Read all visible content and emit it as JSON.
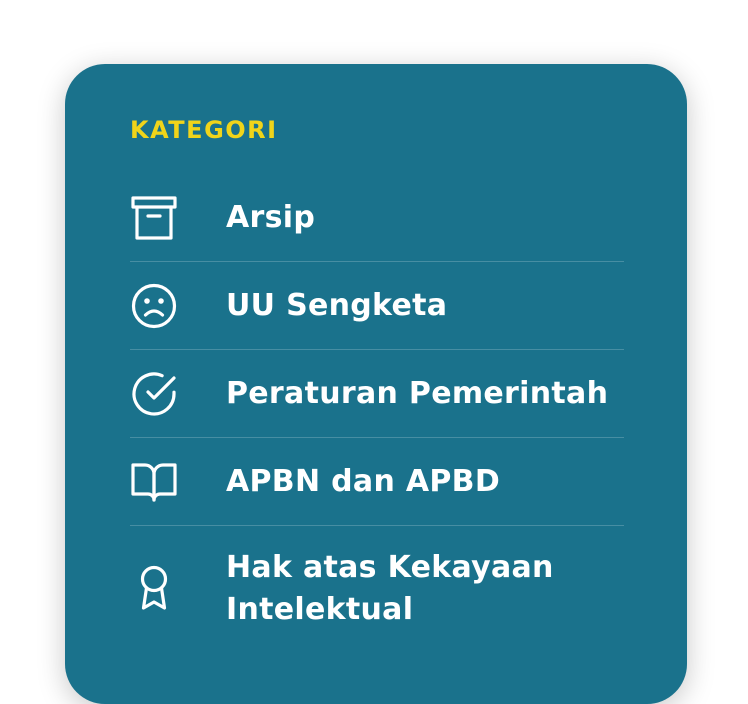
{
  "category_card": {
    "heading": "KATEGORI",
    "items": [
      {
        "label": "Arsip",
        "icon": "archive-box-icon"
      },
      {
        "label": "UU Sengketa",
        "icon": "sad-face-icon"
      },
      {
        "label": "Peraturan Pemerintah",
        "icon": "check-circle-icon"
      },
      {
        "label": "APBN dan APBD",
        "icon": "open-book-icon"
      },
      {
        "label": "Hak atas Kekayaan Intelektual",
        "icon": "award-ribbon-icon"
      }
    ]
  },
  "colors": {
    "card_background": "#1a728c",
    "heading": "#f0d41a",
    "text": "#ffffff"
  }
}
